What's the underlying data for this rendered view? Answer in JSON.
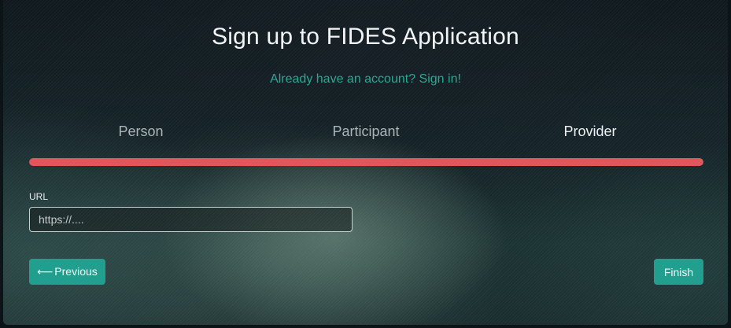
{
  "header": {
    "title": "Sign up to FIDES Application",
    "signin_link": "Already have an account? Sign in!"
  },
  "steps": [
    {
      "label": "Person",
      "active": false
    },
    {
      "label": "Participant",
      "active": false
    },
    {
      "label": "Provider",
      "active": true
    }
  ],
  "progress": {
    "percent": 100,
    "color": "#e0545a"
  },
  "form": {
    "url_label": "URL",
    "url_placeholder": "https://....",
    "url_value": ""
  },
  "buttons": {
    "previous_arrow": "⟵",
    "previous_label": "Previous",
    "finish_label": "Finish"
  },
  "colors": {
    "accent": "#1f9e8d",
    "link": "#2aa693"
  }
}
